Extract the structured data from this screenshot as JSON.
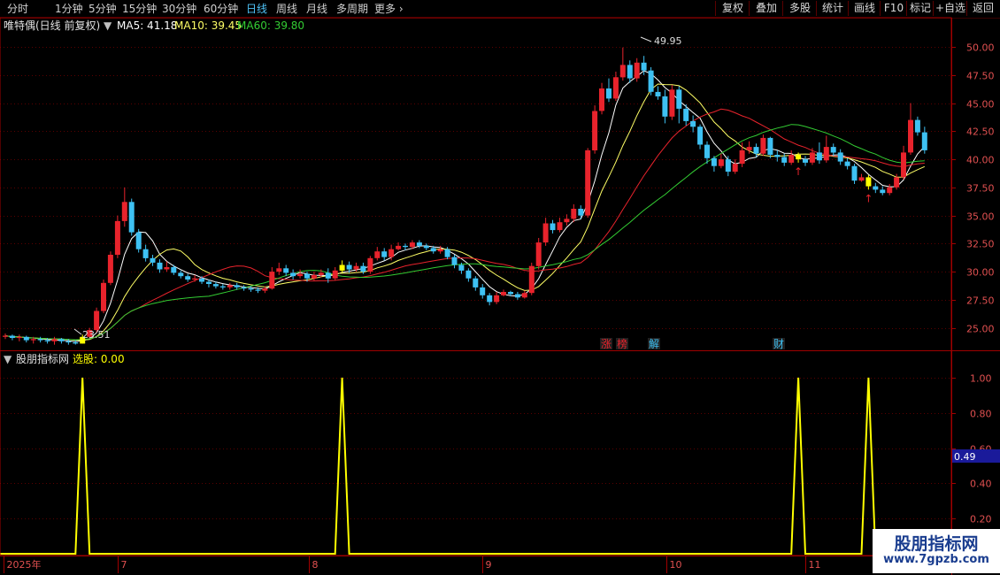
{
  "toolbar": {
    "periods": [
      "分时",
      "1分钟",
      "5分钟",
      "15分钟",
      "30分钟",
      "60分钟",
      "日线",
      "周线",
      "月线",
      "多周期",
      "更多"
    ],
    "selected": "日线",
    "buttons": [
      "复权",
      "叠加",
      "多股",
      "统计",
      "画线",
      "F10",
      "标记",
      "+自选",
      "返回"
    ]
  },
  "main_header": {
    "title": "唯特偶(日线 前复权)",
    "ma5": "MA5: 41.18",
    "ma10": "MA10: 39.45",
    "ma60": "MA60: 39.80"
  },
  "sub_header": {
    "title": "股朋指标网",
    "value": "选股: 0.00"
  },
  "colors": {
    "up": "#e8232c",
    "down": "#3ec1f3",
    "signal": "#ffff00",
    "ma5": "#ffffff",
    "ma10": "#ffff66",
    "ma20": "#e8232c",
    "ma60": "#33cc33",
    "grid": "#5a0000",
    "axis": "#a00000"
  },
  "chart_data": [
    {
      "type": "candlestick",
      "title": "唯特偶(日线 前复权)",
      "ylim": [
        23.0,
        51.5
      ],
      "y_ticks": [
        "50.00",
        "47.50",
        "45.00",
        "42.50",
        "40.00",
        "37.50",
        "35.00",
        "32.50",
        "30.00",
        "27.50",
        "25.00"
      ],
      "x_ticks": [
        "2025年",
        "7",
        "8",
        "9",
        "10",
        "11"
      ],
      "annotations": {
        "high": "49.95",
        "low": "23.51"
      },
      "event_markers": [
        "涨",
        "榜",
        "解",
        "财"
      ],
      "series": [
        {
          "name": "MA5",
          "label": "MA5: 41.18"
        },
        {
          "name": "MA10",
          "label": "MA10: 39.45"
        },
        {
          "name": "MA60",
          "label": "MA60: 39.80"
        }
      ],
      "candles": [
        [
          24.2,
          24.3,
          24.0,
          24.5
        ],
        [
          24.3,
          24.1,
          23.9,
          24.4
        ],
        [
          24.1,
          24.2,
          23.8,
          24.4
        ],
        [
          24.2,
          23.9,
          23.7,
          24.3
        ],
        [
          23.9,
          24.0,
          23.6,
          24.2
        ],
        [
          24.0,
          23.9,
          23.7,
          24.2
        ],
        [
          23.9,
          23.8,
          23.6,
          24.1
        ],
        [
          23.8,
          24.0,
          23.5,
          24.2
        ],
        [
          24.0,
          23.8,
          23.6,
          24.1
        ],
        [
          23.8,
          23.7,
          23.5,
          24.0
        ],
        [
          23.7,
          23.6,
          23.51,
          23.9
        ],
        [
          23.6,
          24.2,
          23.6,
          24.4
        ],
        [
          24.2,
          24.8,
          24.1,
          25.0
        ],
        [
          24.8,
          26.5,
          24.6,
          26.8
        ],
        [
          26.5,
          29.0,
          26.3,
          29.3
        ],
        [
          29.0,
          31.5,
          28.8,
          31.8
        ],
        [
          31.5,
          34.5,
          31.2,
          35.0
        ],
        [
          34.5,
          36.2,
          34.0,
          37.5
        ],
        [
          36.2,
          33.5,
          33.2,
          36.5
        ],
        [
          33.5,
          32.0,
          31.7,
          33.8
        ],
        [
          32.0,
          31.2,
          30.9,
          32.4
        ],
        [
          31.2,
          30.8,
          30.5,
          31.5
        ],
        [
          30.8,
          30.2,
          29.9,
          31.1
        ],
        [
          30.2,
          30.4,
          30.0,
          30.9
        ],
        [
          30.4,
          29.9,
          29.7,
          30.6
        ],
        [
          29.9,
          29.6,
          29.4,
          30.1
        ],
        [
          29.6,
          29.3,
          29.1,
          29.8
        ],
        [
          29.3,
          29.4,
          29.1,
          29.7
        ],
        [
          29.4,
          29.1,
          28.9,
          29.6
        ],
        [
          29.1,
          28.9,
          28.6,
          29.3
        ],
        [
          28.9,
          28.7,
          28.5,
          29.1
        ],
        [
          28.7,
          28.6,
          28.4,
          28.9
        ],
        [
          28.6,
          28.8,
          28.4,
          29.0
        ],
        [
          28.8,
          28.6,
          28.4,
          29.0
        ],
        [
          28.6,
          28.5,
          28.3,
          28.8
        ],
        [
          28.5,
          28.4,
          28.2,
          28.7
        ],
        [
          28.4,
          28.3,
          28.1,
          28.6
        ],
        [
          28.3,
          28.5,
          28.1,
          28.7
        ],
        [
          28.5,
          30.0,
          28.4,
          30.4
        ],
        [
          30.0,
          30.3,
          29.7,
          30.8
        ],
        [
          30.3,
          29.9,
          29.6,
          30.6
        ],
        [
          29.9,
          29.6,
          29.3,
          30.2
        ],
        [
          29.6,
          29.8,
          29.4,
          30.2
        ],
        [
          29.8,
          29.4,
          29.1,
          30.0
        ],
        [
          29.4,
          29.7,
          29.2,
          30.0
        ],
        [
          29.7,
          29.9,
          29.5,
          30.2
        ],
        [
          29.9,
          29.4,
          29.0,
          30.3
        ],
        [
          29.4,
          30.1,
          29.2,
          30.4
        ],
        [
          30.1,
          30.6,
          29.9,
          31.0
        ],
        [
          30.6,
          30.2,
          29.9,
          30.9
        ],
        [
          30.2,
          30.5,
          30.0,
          30.8
        ],
        [
          30.5,
          30.0,
          29.8,
          30.8
        ],
        [
          30.0,
          31.2,
          29.8,
          31.4
        ],
        [
          31.2,
          31.8,
          31.0,
          32.2
        ],
        [
          31.8,
          31.3,
          31.0,
          32.1
        ],
        [
          31.3,
          32.0,
          31.0,
          32.4
        ],
        [
          32.0,
          32.3,
          31.9,
          32.6
        ],
        [
          32.3,
          32.2,
          31.9,
          32.5
        ],
        [
          32.2,
          32.6,
          32.0,
          32.8
        ],
        [
          32.6,
          32.3,
          32.1,
          32.8
        ],
        [
          32.3,
          32.1,
          31.9,
          32.5
        ],
        [
          32.1,
          31.8,
          31.6,
          32.3
        ],
        [
          31.8,
          32.0,
          31.6,
          32.3
        ],
        [
          32.0,
          31.3,
          31.1,
          32.2
        ],
        [
          31.3,
          30.6,
          30.3,
          31.5
        ],
        [
          30.6,
          30.1,
          29.8,
          30.8
        ],
        [
          30.1,
          29.4,
          29.1,
          30.3
        ],
        [
          29.4,
          28.6,
          28.3,
          29.6
        ],
        [
          28.6,
          27.9,
          27.6,
          28.9
        ],
        [
          27.9,
          27.3,
          27.0,
          28.1
        ],
        [
          27.3,
          27.9,
          27.1,
          28.2
        ],
        [
          27.9,
          28.2,
          27.8,
          28.4
        ],
        [
          28.2,
          28.0,
          27.8,
          28.3
        ],
        [
          28.0,
          27.7,
          27.5,
          28.2
        ],
        [
          27.7,
          28.1,
          27.6,
          28.3
        ],
        [
          28.1,
          30.5,
          27.9,
          30.8
        ],
        [
          30.5,
          32.6,
          30.2,
          33.0
        ],
        [
          32.6,
          34.3,
          32.3,
          34.8
        ],
        [
          34.3,
          33.7,
          33.4,
          34.6
        ],
        [
          33.7,
          34.4,
          33.5,
          34.8
        ],
        [
          34.4,
          34.7,
          34.1,
          35.1
        ],
        [
          34.7,
          35.6,
          34.4,
          36.0
        ],
        [
          35.6,
          35.0,
          34.7,
          35.9
        ],
        [
          35.0,
          40.8,
          34.8,
          41.0
        ],
        [
          40.8,
          44.3,
          40.5,
          44.8
        ],
        [
          44.3,
          46.3,
          44.0,
          46.8
        ],
        [
          46.3,
          45.4,
          45.1,
          47.2
        ],
        [
          45.4,
          47.3,
          45.2,
          47.8
        ],
        [
          47.3,
          48.4,
          47.0,
          49.95
        ],
        [
          48.4,
          47.2,
          46.8,
          48.8
        ],
        [
          47.2,
          48.6,
          46.9,
          49.0
        ],
        [
          48.6,
          47.9,
          47.5,
          49.2
        ],
        [
          47.9,
          46.0,
          45.7,
          48.2
        ],
        [
          46.0,
          45.6,
          45.3,
          46.5
        ],
        [
          45.6,
          43.8,
          43.2,
          46.2
        ],
        [
          43.8,
          46.2,
          43.5,
          46.6
        ],
        [
          46.2,
          44.5,
          43.2,
          46.5
        ],
        [
          44.5,
          43.4,
          43.0,
          44.9
        ],
        [
          43.4,
          42.9,
          42.4,
          43.9
        ],
        [
          42.9,
          41.3,
          40.9,
          43.1
        ],
        [
          41.3,
          40.1,
          39.6,
          41.6
        ],
        [
          40.1,
          39.4,
          38.9,
          40.3
        ],
        [
          39.4,
          40.0,
          39.2,
          40.5
        ],
        [
          40.0,
          38.9,
          38.5,
          40.3
        ],
        [
          38.9,
          39.6,
          38.7,
          40.0
        ],
        [
          39.6,
          40.8,
          39.3,
          41.5
        ],
        [
          40.8,
          41.1,
          40.5,
          41.6
        ],
        [
          41.1,
          40.5,
          40.2,
          41.4
        ],
        [
          40.5,
          41.9,
          40.3,
          42.2
        ],
        [
          41.9,
          40.4,
          40.1,
          42.0
        ],
        [
          40.4,
          40.2,
          39.8,
          40.8
        ],
        [
          40.2,
          39.7,
          39.4,
          40.5
        ],
        [
          39.7,
          40.4,
          39.5,
          40.8
        ],
        [
          40.4,
          40.0,
          39.7,
          40.6
        ],
        [
          40.0,
          39.7,
          39.4,
          40.3
        ],
        [
          39.7,
          40.6,
          39.5,
          41.0
        ],
        [
          40.6,
          39.9,
          39.6,
          41.5
        ],
        [
          39.9,
          41.1,
          39.7,
          42.1
        ],
        [
          41.1,
          40.6,
          40.3,
          41.4
        ],
        [
          40.6,
          39.8,
          39.5,
          40.9
        ],
        [
          39.8,
          39.4,
          39.1,
          40.1
        ],
        [
          39.4,
          38.1,
          37.8,
          39.6
        ],
        [
          38.1,
          38.4,
          38.0,
          38.7
        ],
        [
          38.4,
          37.6,
          37.3,
          38.6
        ],
        [
          37.6,
          37.3,
          37.0,
          37.9
        ],
        [
          37.3,
          37.0,
          36.8,
          37.6
        ],
        [
          37.0,
          37.5,
          36.8,
          37.8
        ],
        [
          37.5,
          38.4,
          37.3,
          38.7
        ],
        [
          38.4,
          40.6,
          38.2,
          41.2
        ],
        [
          40.6,
          43.5,
          40.4,
          45.0
        ],
        [
          43.5,
          42.4,
          42.1,
          43.8
        ],
        [
          42.4,
          40.8,
          40.5,
          42.9
        ]
      ],
      "signal_candles": [
        11,
        48,
        113,
        123
      ]
    },
    {
      "type": "line",
      "title": "股朋指标网",
      "ylim": [
        0,
        1.1
      ],
      "y_ticks": [
        "1.00",
        "0.80",
        "0.60",
        "0.40",
        "0.20"
      ],
      "current_label": "0.49",
      "series": [
        {
          "name": "选股",
          "label": "选股: 0.00",
          "spikes": [
            11,
            48,
            113,
            123
          ]
        }
      ]
    }
  ]
}
